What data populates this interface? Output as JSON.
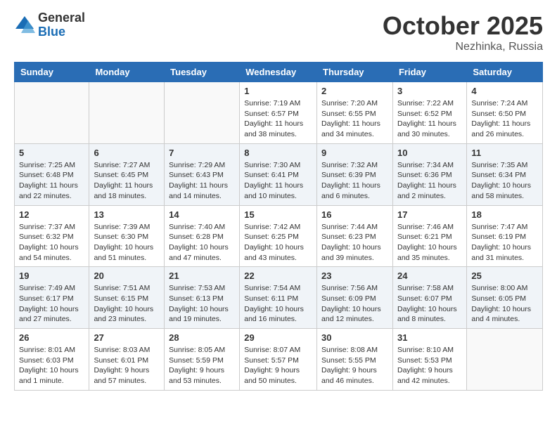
{
  "header": {
    "logo_general": "General",
    "logo_blue": "Blue",
    "month_title": "October 2025",
    "location": "Nezhinka, Russia"
  },
  "weekdays": [
    "Sunday",
    "Monday",
    "Tuesday",
    "Wednesday",
    "Thursday",
    "Friday",
    "Saturday"
  ],
  "weeks": [
    [
      {
        "day": "",
        "info": ""
      },
      {
        "day": "",
        "info": ""
      },
      {
        "day": "",
        "info": ""
      },
      {
        "day": "1",
        "info": "Sunrise: 7:19 AM\nSunset: 6:57 PM\nDaylight: 11 hours and 38 minutes."
      },
      {
        "day": "2",
        "info": "Sunrise: 7:20 AM\nSunset: 6:55 PM\nDaylight: 11 hours and 34 minutes."
      },
      {
        "day": "3",
        "info": "Sunrise: 7:22 AM\nSunset: 6:52 PM\nDaylight: 11 hours and 30 minutes."
      },
      {
        "day": "4",
        "info": "Sunrise: 7:24 AM\nSunset: 6:50 PM\nDaylight: 11 hours and 26 minutes."
      }
    ],
    [
      {
        "day": "5",
        "info": "Sunrise: 7:25 AM\nSunset: 6:48 PM\nDaylight: 11 hours and 22 minutes."
      },
      {
        "day": "6",
        "info": "Sunrise: 7:27 AM\nSunset: 6:45 PM\nDaylight: 11 hours and 18 minutes."
      },
      {
        "day": "7",
        "info": "Sunrise: 7:29 AM\nSunset: 6:43 PM\nDaylight: 11 hours and 14 minutes."
      },
      {
        "day": "8",
        "info": "Sunrise: 7:30 AM\nSunset: 6:41 PM\nDaylight: 11 hours and 10 minutes."
      },
      {
        "day": "9",
        "info": "Sunrise: 7:32 AM\nSunset: 6:39 PM\nDaylight: 11 hours and 6 minutes."
      },
      {
        "day": "10",
        "info": "Sunrise: 7:34 AM\nSunset: 6:36 PM\nDaylight: 11 hours and 2 minutes."
      },
      {
        "day": "11",
        "info": "Sunrise: 7:35 AM\nSunset: 6:34 PM\nDaylight: 10 hours and 58 minutes."
      }
    ],
    [
      {
        "day": "12",
        "info": "Sunrise: 7:37 AM\nSunset: 6:32 PM\nDaylight: 10 hours and 54 minutes."
      },
      {
        "day": "13",
        "info": "Sunrise: 7:39 AM\nSunset: 6:30 PM\nDaylight: 10 hours and 51 minutes."
      },
      {
        "day": "14",
        "info": "Sunrise: 7:40 AM\nSunset: 6:28 PM\nDaylight: 10 hours and 47 minutes."
      },
      {
        "day": "15",
        "info": "Sunrise: 7:42 AM\nSunset: 6:25 PM\nDaylight: 10 hours and 43 minutes."
      },
      {
        "day": "16",
        "info": "Sunrise: 7:44 AM\nSunset: 6:23 PM\nDaylight: 10 hours and 39 minutes."
      },
      {
        "day": "17",
        "info": "Sunrise: 7:46 AM\nSunset: 6:21 PM\nDaylight: 10 hours and 35 minutes."
      },
      {
        "day": "18",
        "info": "Sunrise: 7:47 AM\nSunset: 6:19 PM\nDaylight: 10 hours and 31 minutes."
      }
    ],
    [
      {
        "day": "19",
        "info": "Sunrise: 7:49 AM\nSunset: 6:17 PM\nDaylight: 10 hours and 27 minutes."
      },
      {
        "day": "20",
        "info": "Sunrise: 7:51 AM\nSunset: 6:15 PM\nDaylight: 10 hours and 23 minutes."
      },
      {
        "day": "21",
        "info": "Sunrise: 7:53 AM\nSunset: 6:13 PM\nDaylight: 10 hours and 19 minutes."
      },
      {
        "day": "22",
        "info": "Sunrise: 7:54 AM\nSunset: 6:11 PM\nDaylight: 10 hours and 16 minutes."
      },
      {
        "day": "23",
        "info": "Sunrise: 7:56 AM\nSunset: 6:09 PM\nDaylight: 10 hours and 12 minutes."
      },
      {
        "day": "24",
        "info": "Sunrise: 7:58 AM\nSunset: 6:07 PM\nDaylight: 10 hours and 8 minutes."
      },
      {
        "day": "25",
        "info": "Sunrise: 8:00 AM\nSunset: 6:05 PM\nDaylight: 10 hours and 4 minutes."
      }
    ],
    [
      {
        "day": "26",
        "info": "Sunrise: 8:01 AM\nSunset: 6:03 PM\nDaylight: 10 hours and 1 minute."
      },
      {
        "day": "27",
        "info": "Sunrise: 8:03 AM\nSunset: 6:01 PM\nDaylight: 9 hours and 57 minutes."
      },
      {
        "day": "28",
        "info": "Sunrise: 8:05 AM\nSunset: 5:59 PM\nDaylight: 9 hours and 53 minutes."
      },
      {
        "day": "29",
        "info": "Sunrise: 8:07 AM\nSunset: 5:57 PM\nDaylight: 9 hours and 50 minutes."
      },
      {
        "day": "30",
        "info": "Sunrise: 8:08 AM\nSunset: 5:55 PM\nDaylight: 9 hours and 46 minutes."
      },
      {
        "day": "31",
        "info": "Sunrise: 8:10 AM\nSunset: 5:53 PM\nDaylight: 9 hours and 42 minutes."
      },
      {
        "day": "",
        "info": ""
      }
    ]
  ]
}
